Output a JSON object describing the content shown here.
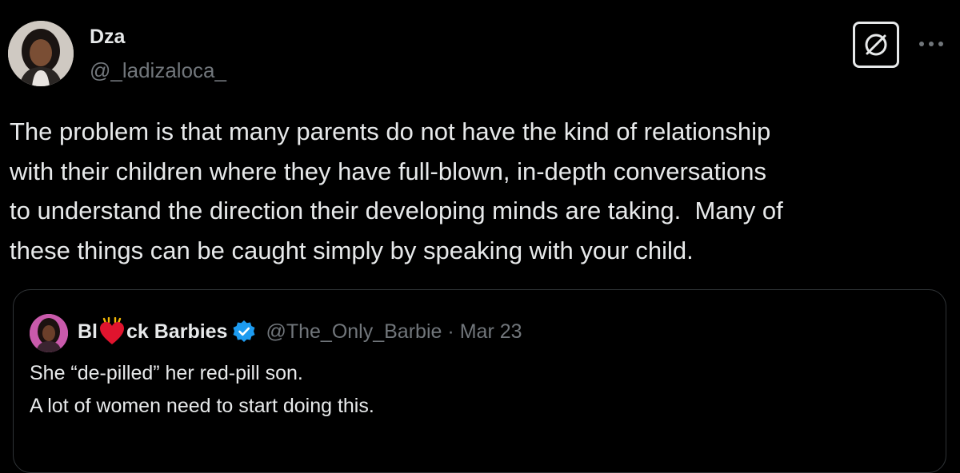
{
  "tweet": {
    "author": {
      "display_name": "Dza",
      "handle": "@_ladizaloca_",
      "avatar_icon": "profile-photo"
    },
    "grok_icon": "grok-icon",
    "more_icon": "more-icon",
    "text": "The problem is that many parents do not have the kind of relationship\nwith their children where they have full-blown, in-depth conversations\nto understand the direction their developing minds are taking.  Many of\nthese things can be caught simply by speaking with your child."
  },
  "quote": {
    "author": {
      "name_part1": "Bl",
      "name_part2": "ck Barbies",
      "heart_icon": "red-heart-emoji",
      "verified_icon": "verified-badge-icon",
      "handle": "@The_Only_Barbie",
      "separator": "·",
      "date": "Mar 23"
    },
    "text": "She “de-pilled” her red-pill son.\nA lot of women need to start doing this."
  },
  "colors": {
    "background": "#000000",
    "primary_text": "#e7e9ea",
    "secondary_text": "#71767b",
    "border": "#2f3336",
    "verified_blue": "#1d9bf0",
    "heart_red": "#e0142e"
  }
}
